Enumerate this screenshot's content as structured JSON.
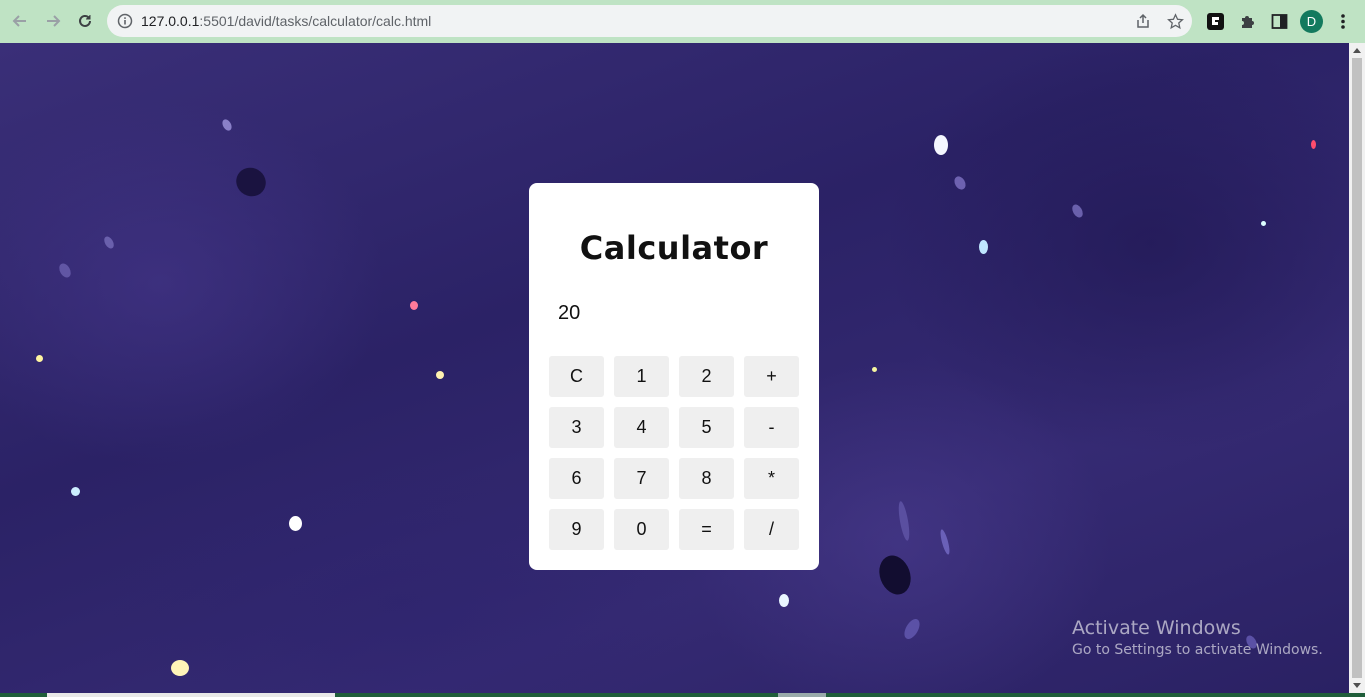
{
  "browser": {
    "url_host": "127.0.0.1",
    "url_port": ":5501",
    "url_path": "/david/tasks/calculator/calc.html",
    "profile_initial": "D",
    "icons": [
      "back-icon",
      "forward-icon",
      "reload-icon",
      "site-info-icon",
      "share-icon",
      "bookmark-star-icon",
      "extension-app-icon",
      "extensions-puzzle-icon",
      "side-panel-icon",
      "menu-kebab-icon"
    ]
  },
  "calculator": {
    "title": "Calculator",
    "display_value": "20",
    "keys": [
      "C",
      "1",
      "2",
      "+",
      "3",
      "4",
      "5",
      "-",
      "6",
      "7",
      "8",
      "*",
      "9",
      "0",
      "=",
      "/"
    ]
  },
  "watermark": {
    "line1": "Activate Windows",
    "line2": "Go to Settings to activate Windows."
  },
  "colors": {
    "chrome_bar": "#bfe3c4",
    "avatar": "#137a5e",
    "background": "#2b2266",
    "card": "#ffffff",
    "key": "#efefef"
  }
}
